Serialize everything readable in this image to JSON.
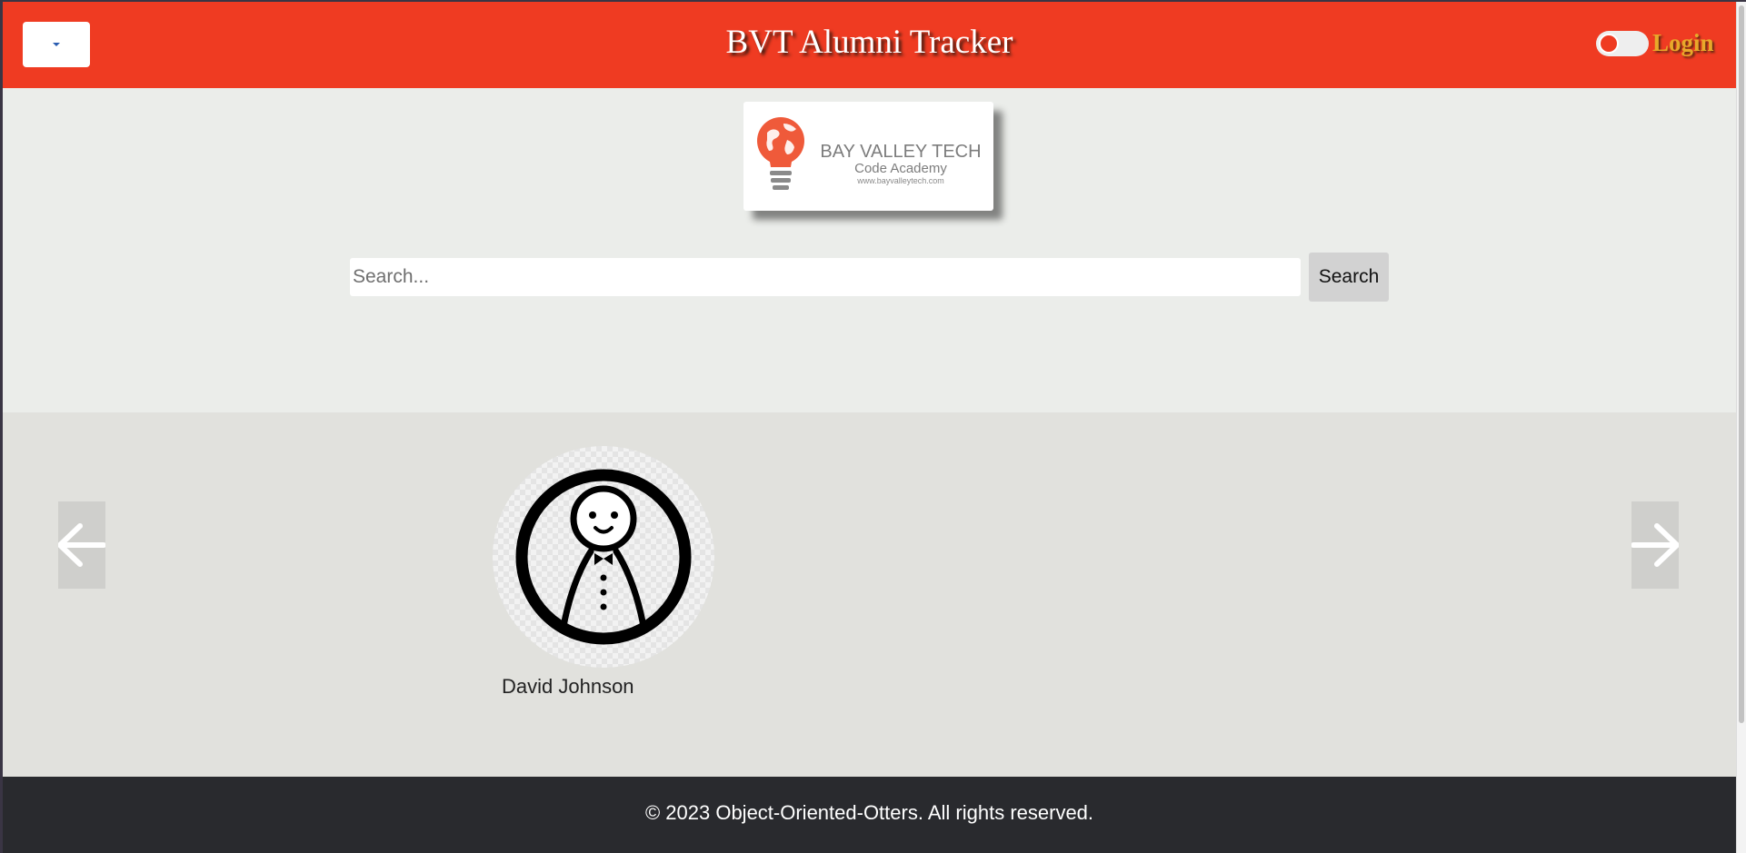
{
  "header": {
    "title": "BVT Alumni Tracker",
    "login_label": "Login"
  },
  "logo": {
    "name": "BAY VALLEY TECH",
    "subtitle": "Code Academy",
    "url": "www.bayvalleytech.com"
  },
  "search": {
    "placeholder": "Search...",
    "value": "",
    "button_label": "Search"
  },
  "carousel": {
    "profiles": [
      {
        "name": "David Johnson"
      }
    ]
  },
  "footer": {
    "text": "© 2023 Object-Oriented-Otters. All rights reserved."
  },
  "colors": {
    "header_bg": "#ef3b22",
    "login_text": "#e8a82a",
    "page_bg": "#ebedea",
    "carousel_bg": "#e1e1dd",
    "footer_bg": "#292a2e"
  },
  "icons": {
    "menu": "caret-down-icon",
    "prev": "arrow-left-icon",
    "next": "arrow-right-icon",
    "avatar": "stick-figure-icon",
    "logo": "lightbulb-globe-icon"
  }
}
